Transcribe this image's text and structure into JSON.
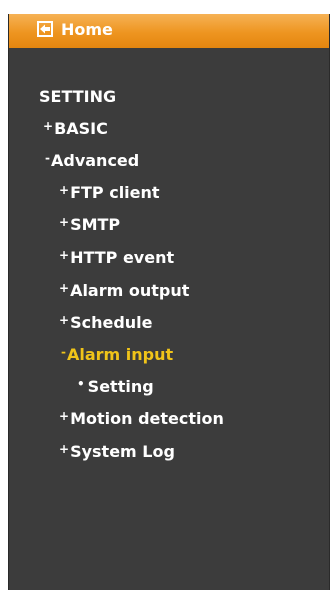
{
  "header": {
    "home_label": "Home",
    "icon": "back-arrow-icon",
    "bar_color": "#ee9520"
  },
  "menu": {
    "title": "SETTING",
    "items": [
      {
        "marker": "+",
        "label": "BASIC"
      },
      {
        "marker": "-",
        "label": "Advanced"
      },
      {
        "marker": "+",
        "label": "FTP client"
      },
      {
        "marker": "+",
        "label": "SMTP"
      },
      {
        "marker": "+",
        "label": "HTTP event"
      },
      {
        "marker": "+",
        "label": "Alarm output"
      },
      {
        "marker": "+",
        "label": "Schedule"
      },
      {
        "marker": "-",
        "label": "Alarm input"
      },
      {
        "marker": "•",
        "label": "Setting"
      },
      {
        "marker": "+",
        "label": "Motion detection"
      },
      {
        "marker": "+",
        "label": "System Log"
      }
    ],
    "active_item": "Alarm input",
    "active_color": "#f0c419",
    "background_color": "#3c3c3c"
  }
}
